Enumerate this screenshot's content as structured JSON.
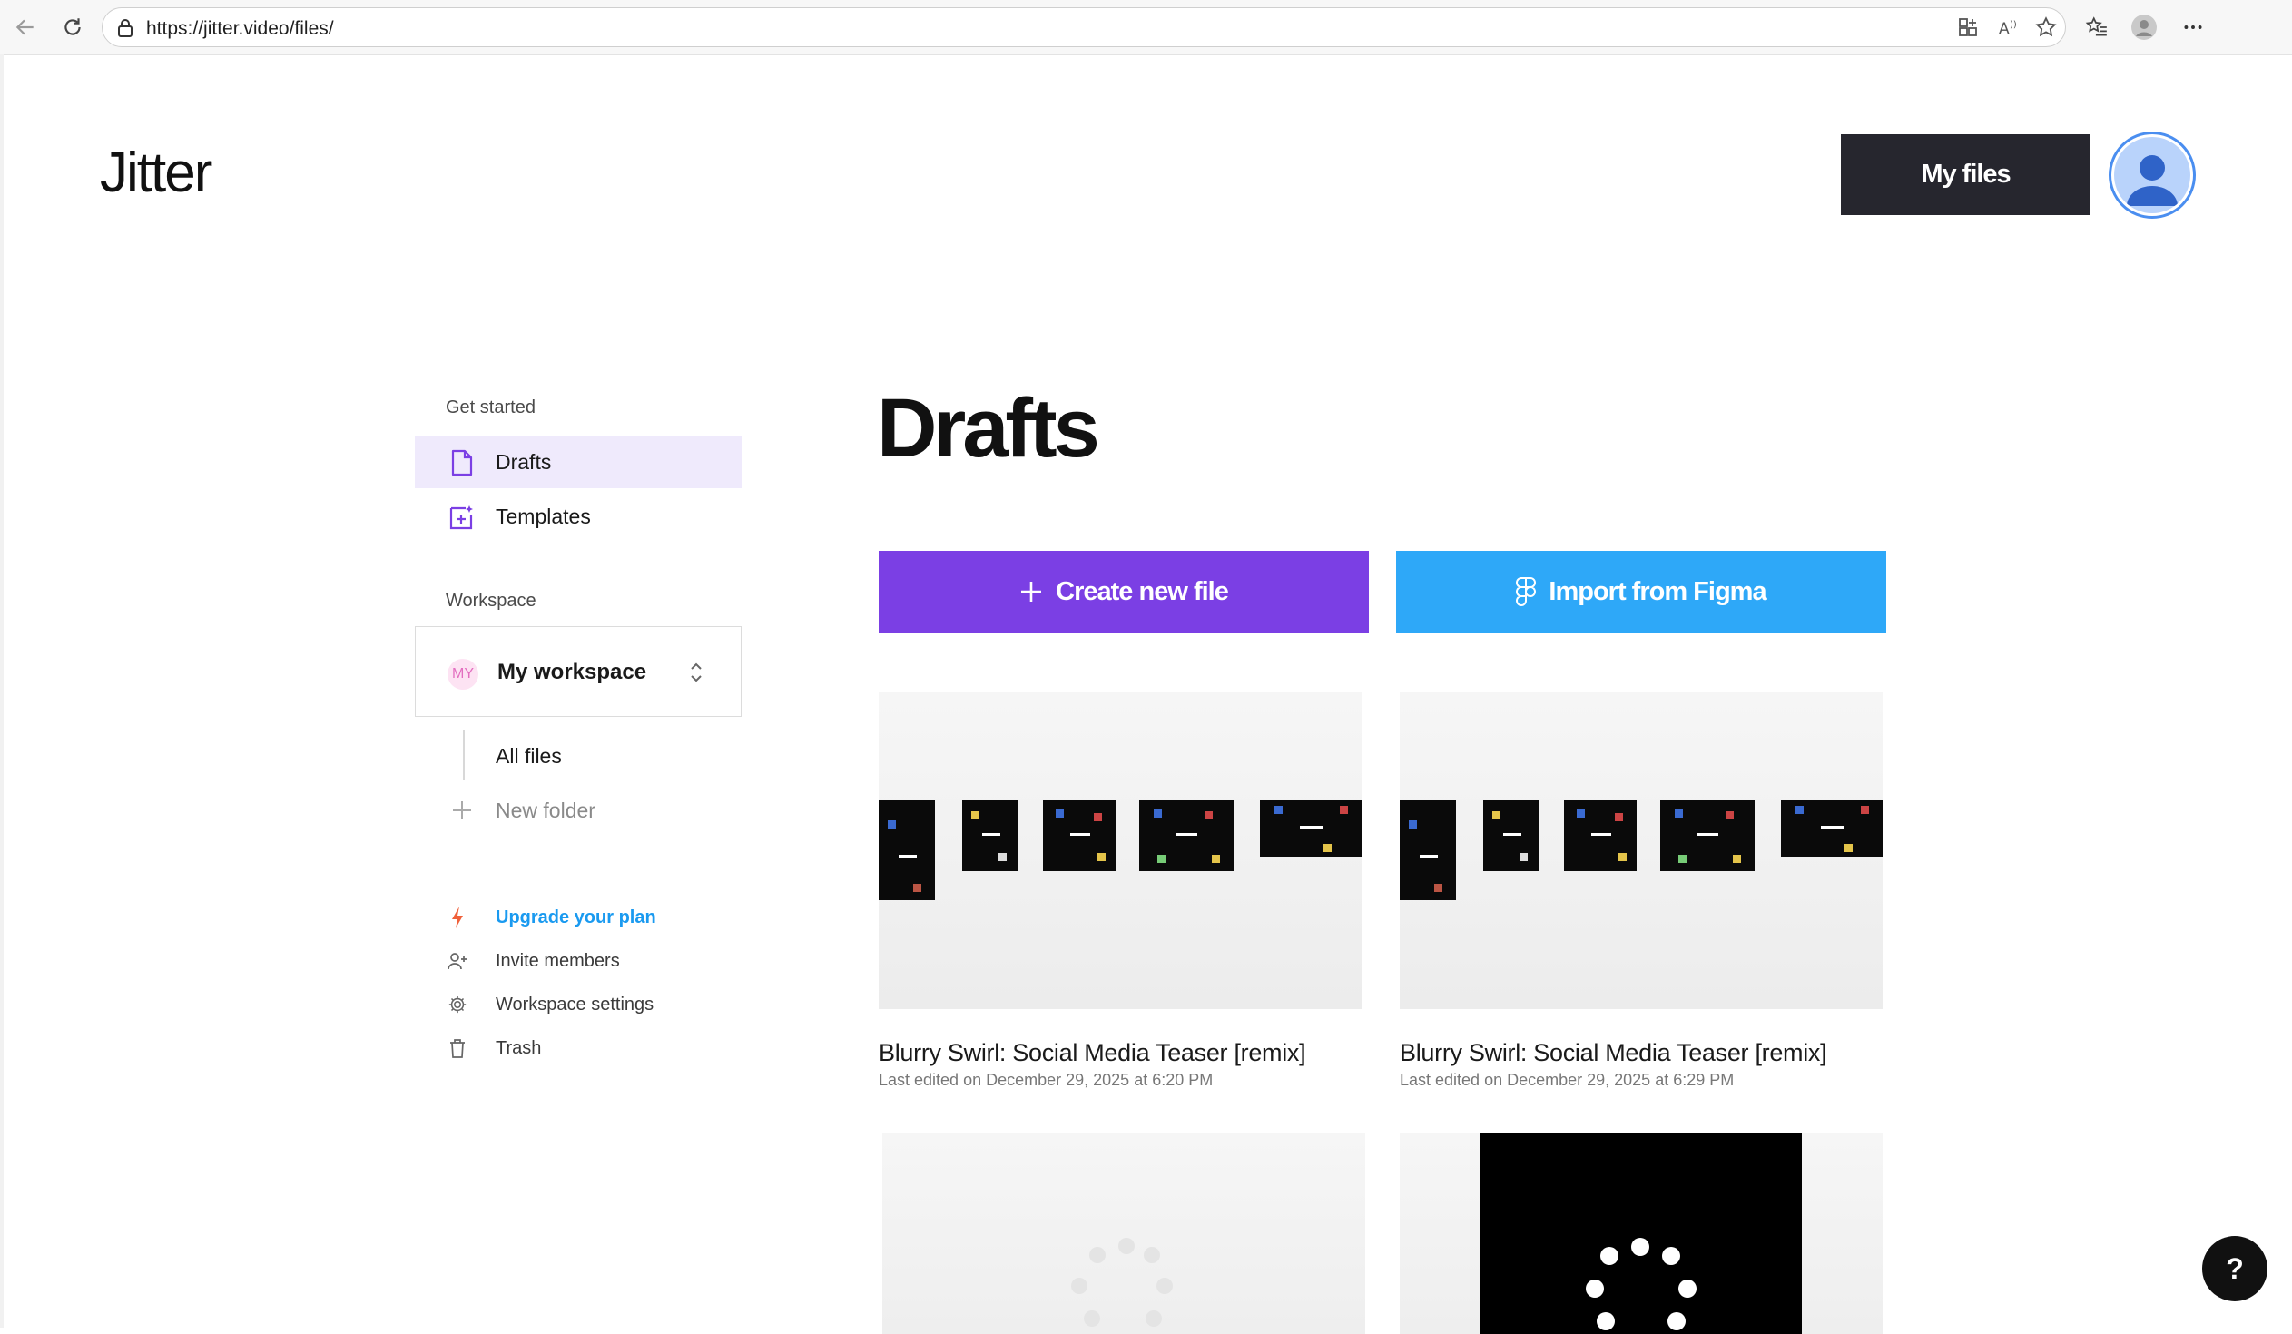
{
  "browser": {
    "url": "https://jitter.video/files/"
  },
  "header": {
    "logo": "Jitter",
    "my_files": "My files"
  },
  "sidebar": {
    "get_started_label": "Get started",
    "items": [
      {
        "label": "Drafts",
        "icon": "file-icon",
        "active": true
      },
      {
        "label": "Templates",
        "icon": "template-icon",
        "active": false
      }
    ],
    "workspace_label": "Workspace",
    "workspace": {
      "badge": "MY",
      "name": "My workspace"
    },
    "folders": [
      {
        "label": "All files"
      },
      {
        "label": "New folder"
      }
    ],
    "footer_links": [
      {
        "label": "Upgrade your plan",
        "icon": "lightning-icon",
        "color": "#1a9af0"
      },
      {
        "label": "Invite members",
        "icon": "user-plus-icon"
      },
      {
        "label": "Workspace settings",
        "icon": "gear-icon"
      },
      {
        "label": "Trash",
        "icon": "trash-icon"
      }
    ]
  },
  "main": {
    "title": "Drafts",
    "create_button": "Create new file",
    "import_button": "Import from Figma",
    "files": [
      {
        "title": "Blurry Swirl: Social Media Teaser [remix]",
        "edited": "Last edited on December 29, 2025 at 6:20 PM"
      },
      {
        "title": "Blurry Swirl: Social Media Teaser [remix]",
        "edited": "Last edited on December 29, 2025 at 6:29 PM"
      }
    ]
  },
  "help": {
    "label": "?"
  },
  "colors": {
    "accent_purple": "#7b3fe4",
    "figma_blue": "#2ea8f8",
    "dark_button": "#26262e",
    "active_bg": "#efeafc"
  }
}
